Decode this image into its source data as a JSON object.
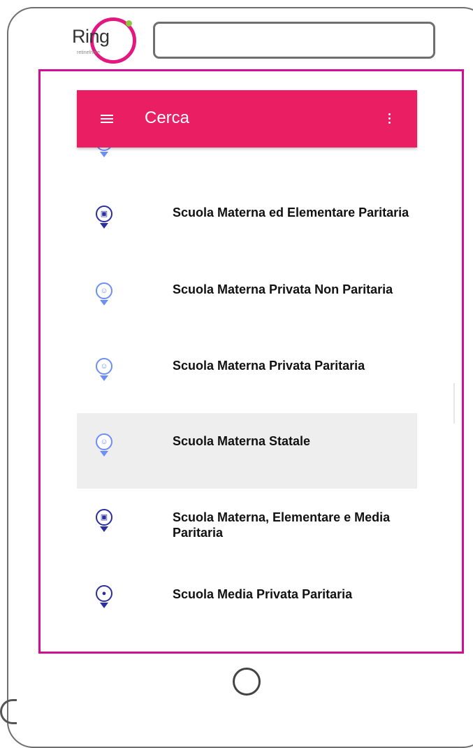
{
  "brand": {
    "logo_text": "Ring",
    "logo_subtext": "retinelnere",
    "accent": "#e4177f",
    "dot_color": "#8cc63f"
  },
  "browser": {
    "url_value": ""
  },
  "appbar": {
    "title": "Cerca",
    "color": "#e91e63",
    "menu_icon": "hamburger-menu-icon",
    "more_icon": "more-vert-icon"
  },
  "list": {
    "items": [
      {
        "label": "",
        "icon": "school-pin-icon",
        "style": "light"
      },
      {
        "label": "Scuola Materna ed Elementare Paritaria",
        "icon": "school-pin-icon",
        "style": "dark"
      },
      {
        "label": "Scuola Materna Privata Non Paritaria",
        "icon": "kindergarten-pin-icon",
        "style": "light"
      },
      {
        "label": "Scuola Materna Privata Paritaria",
        "icon": "kindergarten-pin-icon",
        "style": "light"
      },
      {
        "label": "Scuola Materna Statale",
        "icon": "kindergarten-pin-icon",
        "style": "light",
        "selected": true
      },
      {
        "label": "Scuola Materna, Elementare e Media Paritaria",
        "icon": "school-pin-icon",
        "style": "dark"
      },
      {
        "label": "Scuola Media Privata Paritaria",
        "icon": "school-pin-icon",
        "style": "dark"
      }
    ]
  },
  "colors": {
    "frame": "#6f6f6f",
    "screen_border": "#d10f94",
    "pin_light": "#6d8ef5",
    "pin_dark": "#2b2f9e",
    "selected_bg": "#eeeeee"
  }
}
